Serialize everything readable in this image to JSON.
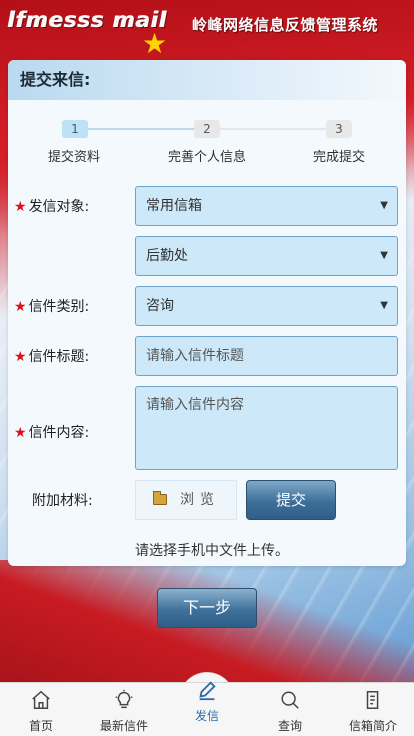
{
  "header": {
    "logo_en": "lfmesss mail",
    "title": "岭峰网络信息反馈管理系统"
  },
  "card": {
    "title": "提交来信:"
  },
  "steps": [
    {
      "num": "1",
      "label": "提交资料"
    },
    {
      "num": "2",
      "label": "完善个人信息"
    },
    {
      "num": "3",
      "label": "完成提交"
    }
  ],
  "form": {
    "target_label": "发信对象:",
    "target_value": "常用信箱",
    "dept_value": "后勤处",
    "category_label": "信件类别:",
    "category_value": "咨询",
    "subject_label": "信件标题:",
    "subject_placeholder": "请输入信件标题",
    "content_label": "信件内容:",
    "content_placeholder": "请输入信件内容",
    "attach_label": "附加材料:",
    "browse_label": "浏览",
    "submit_label": "提交",
    "hint": "请选择手机中文件上传。",
    "required_mark": "★",
    "caret": "▼"
  },
  "next_button": "下一步",
  "tabbar": [
    {
      "label": "首页",
      "icon": "home-icon"
    },
    {
      "label": "最新信件",
      "icon": "lightbulb-icon"
    },
    {
      "label": "发信",
      "icon": "pen-icon"
    },
    {
      "label": "查询",
      "icon": "search-icon"
    },
    {
      "label": "信箱简介",
      "icon": "document-icon"
    }
  ],
  "colors": {
    "accent": "#2b6bb0",
    "required": "#e0101a",
    "field_bg": "#cde8f8",
    "button": "#3c6f98"
  }
}
